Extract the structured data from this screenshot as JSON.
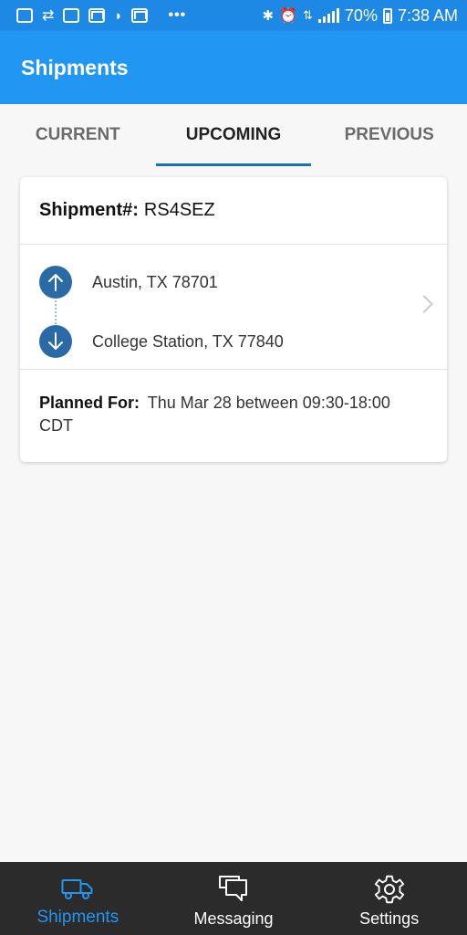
{
  "status_bar": {
    "battery": "70%",
    "time": "7:38 AM",
    "dots": "•••"
  },
  "app_bar": {
    "title": "Shipments"
  },
  "tabs": [
    {
      "label": "CURRENT",
      "active": false
    },
    {
      "label": "UPCOMING",
      "active": true
    },
    {
      "label": "PREVIOUS",
      "active": false
    }
  ],
  "shipment": {
    "number_label": "Shipment#:",
    "number": "RS4SEZ",
    "origin": "Austin, TX 78701",
    "destination": "College Station, TX 77840",
    "planned_label": "Planned For:",
    "planned_value": "Thu Mar 28 between 09:30-18:00 CDT"
  },
  "bottom_nav": [
    {
      "label": "Shipments",
      "icon": "truck-icon",
      "active": true
    },
    {
      "label": "Messaging",
      "icon": "chat-bubbles-icon",
      "active": false
    },
    {
      "label": "Settings",
      "icon": "gear-icon",
      "active": false
    }
  ],
  "colors": {
    "primary": "#2196f3",
    "status_bar": "#1e88e5",
    "tab_indicator": "#1e6fb0",
    "route_circle": "#2a6aa6",
    "bottom_nav": "#2b2b2b"
  }
}
